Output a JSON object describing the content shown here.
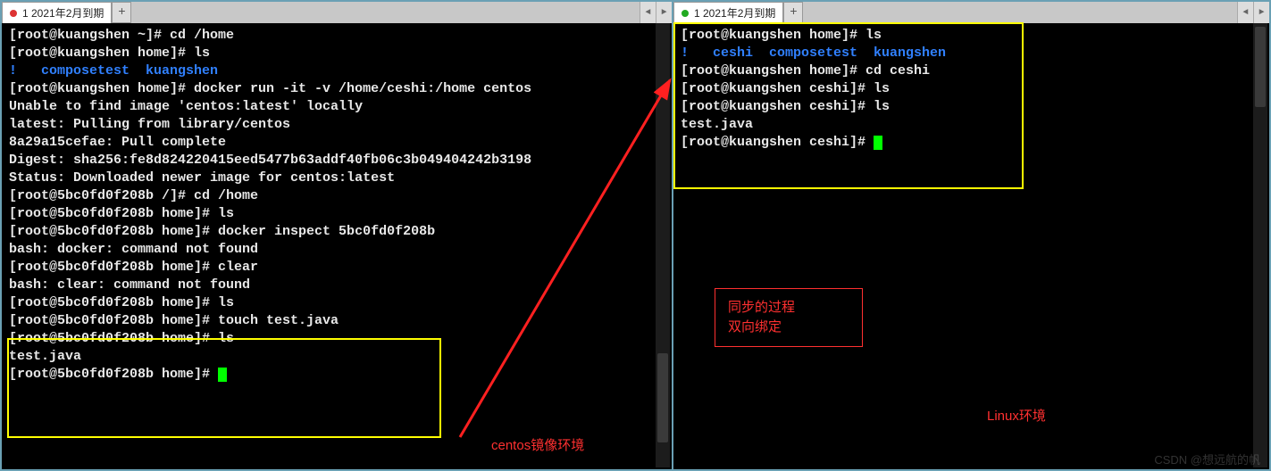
{
  "left": {
    "tab": {
      "label": "1 2021年2月到期",
      "dot": "dot-red"
    },
    "lines": [
      {
        "segs": [
          [
            "[root@kuangshen ~]# cd /home",
            ""
          ]
        ]
      },
      {
        "segs": [
          [
            "[root@kuangshen home]# ls",
            ""
          ]
        ]
      },
      {
        "segs": [
          [
            "!   ",
            "blue"
          ],
          [
            "composetest  kuangshen",
            "blue"
          ]
        ]
      },
      {
        "segs": [
          [
            "[root@kuangshen home]# docker run -it -v /home/ceshi:/home centos",
            ""
          ]
        ]
      },
      {
        "segs": [
          [
            "Unable to find image 'centos:latest' locally",
            ""
          ]
        ]
      },
      {
        "segs": [
          [
            "latest: Pulling from library/centos",
            ""
          ]
        ]
      },
      {
        "segs": [
          [
            "8a29a15cefae: Pull complete",
            ""
          ]
        ]
      },
      {
        "segs": [
          [
            "Digest: sha256:fe8d824220415eed5477b63addf40fb06c3b049404242b3198",
            ""
          ]
        ]
      },
      {
        "segs": [
          [
            "Status: Downloaded newer image for centos:latest",
            ""
          ]
        ]
      },
      {
        "segs": [
          [
            "[root@5bc0fd0f208b /]# cd /home",
            ""
          ]
        ]
      },
      {
        "segs": [
          [
            "[root@5bc0fd0f208b home]# ls",
            ""
          ]
        ]
      },
      {
        "segs": [
          [
            "[root@5bc0fd0f208b home]# docker inspect 5bc0fd0f208b",
            ""
          ]
        ]
      },
      {
        "segs": [
          [
            "bash: docker: command not found",
            ""
          ]
        ]
      },
      {
        "segs": [
          [
            "[root@5bc0fd0f208b home]# clear",
            ""
          ]
        ]
      },
      {
        "segs": [
          [
            "bash: clear: command not found",
            ""
          ]
        ]
      },
      {
        "segs": [
          [
            "[root@5bc0fd0f208b home]# ls",
            ""
          ]
        ]
      },
      {
        "segs": [
          [
            "[root@5bc0fd0f208b home]# touch test.java",
            ""
          ]
        ]
      },
      {
        "segs": [
          [
            "[root@5bc0fd0f208b home]# ls",
            ""
          ]
        ]
      },
      {
        "segs": [
          [
            "test.java",
            ""
          ]
        ]
      },
      {
        "segs": [
          [
            "[root@5bc0fd0f208b home]# ",
            ""
          ]
        ],
        "cursor": true
      }
    ]
  },
  "right": {
    "tab": {
      "label": "1 2021年2月到期",
      "dot": "dot-green"
    },
    "lines": [
      {
        "segs": [
          [
            "[root@kuangshen home]# ls",
            ""
          ]
        ]
      },
      {
        "segs": [
          [
            "!   ceshi  composetest  kuangshen",
            "blue"
          ]
        ]
      },
      {
        "segs": [
          [
            "[root@kuangshen home]# cd ceshi",
            ""
          ]
        ]
      },
      {
        "segs": [
          [
            "[root@kuangshen ceshi]# ls",
            ""
          ]
        ]
      },
      {
        "segs": [
          [
            "[root@kuangshen ceshi]# ls",
            ""
          ]
        ]
      },
      {
        "segs": [
          [
            "test.java",
            ""
          ]
        ]
      },
      {
        "segs": [
          [
            "[root@kuangshen ceshi]# ",
            ""
          ]
        ],
        "cursor": true
      }
    ]
  },
  "annotations": {
    "centos": "centos镜像环境",
    "linux": "Linux环境",
    "box_line1": "同步的过程",
    "box_line2": "双向绑定"
  },
  "watermark": "CSDN @想远航的帆",
  "icons": {
    "plus": "+",
    "left_arrow": "◄",
    "right_arrow": "►"
  }
}
